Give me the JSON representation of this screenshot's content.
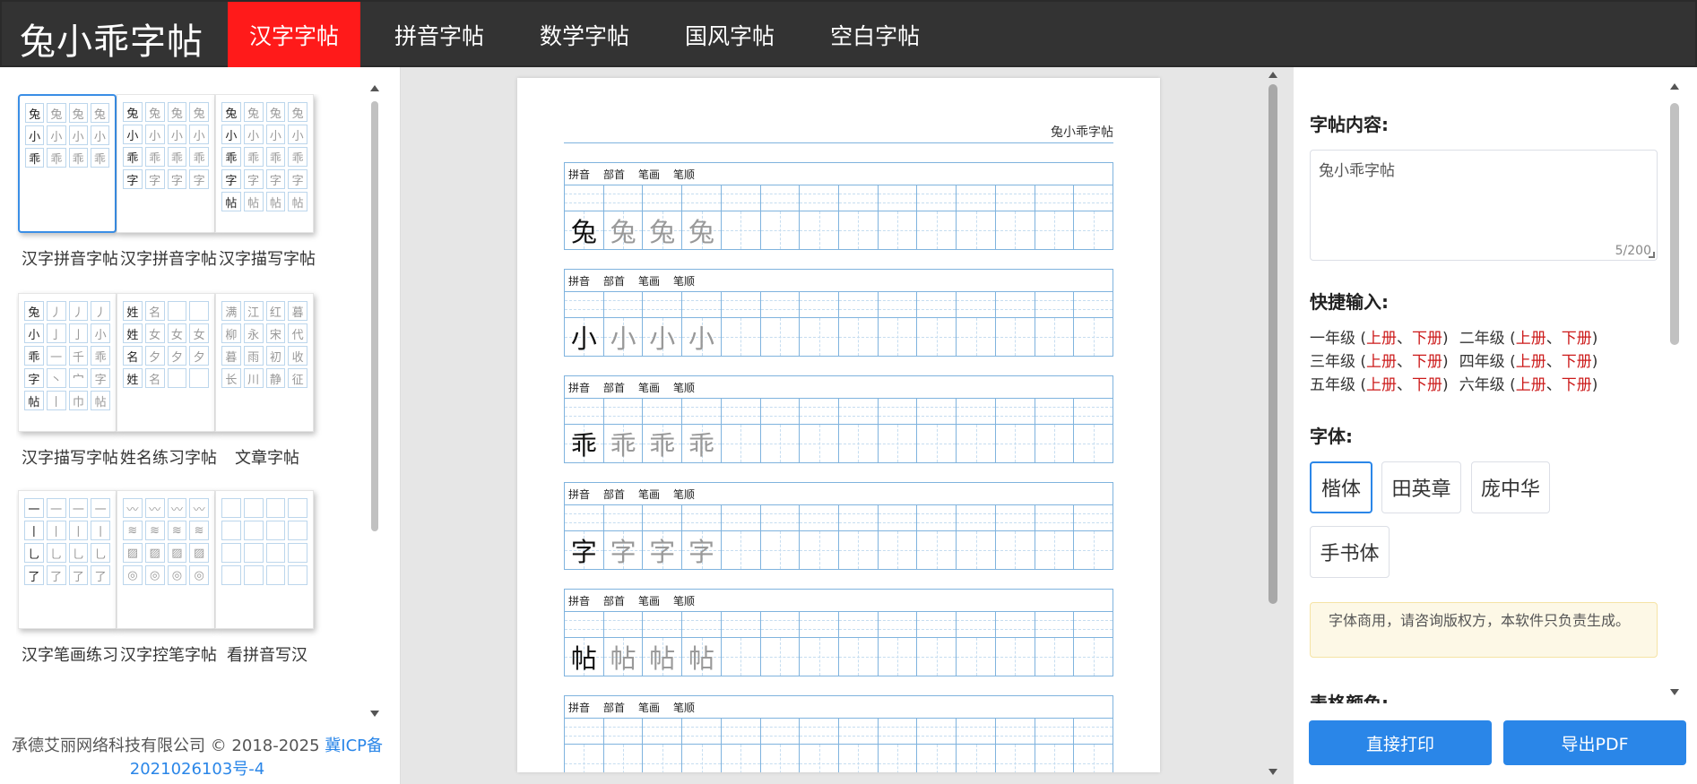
{
  "app": {
    "logo": "兔小乖字帖"
  },
  "nav": [
    {
      "label": "汉字字帖",
      "active": true
    },
    {
      "label": "拼音字帖"
    },
    {
      "label": "数学字帖"
    },
    {
      "label": "国风字帖"
    },
    {
      "label": "空白字帖"
    }
  ],
  "templates": [
    {
      "label": "汉字拼音字帖"
    },
    {
      "label": "汉字拼音字帖"
    },
    {
      "label": "汉字描写字帖"
    },
    {
      "label": "汉字描写字帖"
    },
    {
      "label": "姓名练习字帖"
    },
    {
      "label": "文章字帖"
    },
    {
      "label": "汉字笔画练习"
    },
    {
      "label": "汉字控笔字帖"
    },
    {
      "label": "看拼音写汉"
    }
  ],
  "footer": {
    "company": "承德艾丽网络科技有限公司 © 2018-2025",
    "icp": "冀ICP备2021026103号-4"
  },
  "preview": {
    "header": "兔小乖字帖",
    "labels": {
      "pinyin": "拼音",
      "radical": "部首",
      "strokes": "笔画",
      "order": "笔顺"
    },
    "chars": [
      "兔",
      "小",
      "乖",
      "字",
      "帖",
      ""
    ]
  },
  "settings": {
    "content_title": "字帖内容:",
    "content_value": "兔小乖字帖",
    "counter": "5/200",
    "quick_title": "快捷输入:",
    "grades": [
      {
        "grade": "一年级",
        "a": "上册",
        "b": "下册"
      },
      {
        "grade": "二年级",
        "a": "上册",
        "b": "下册"
      },
      {
        "grade": "三年级",
        "a": "上册",
        "b": "下册"
      },
      {
        "grade": "四年级",
        "a": "上册",
        "b": "下册"
      },
      {
        "grade": "五年级",
        "a": "上册",
        "b": "下册"
      },
      {
        "grade": "六年级",
        "a": "上册",
        "b": "下册"
      }
    ],
    "font_title": "字体:",
    "fonts": [
      "楷体",
      "田英章",
      "庞中华",
      "手书体"
    ],
    "notice": "字体商用，请咨询版权方，本软件只负责生成。",
    "next_title": "表格颜色:"
  },
  "actions": {
    "print": "直接打印",
    "pdf": "导出PDF"
  },
  "colors": {
    "accent": "#2a86e8",
    "nav_active": "#ff1a1a",
    "topbar": "#333333",
    "grid_line": "#7fb3de"
  }
}
